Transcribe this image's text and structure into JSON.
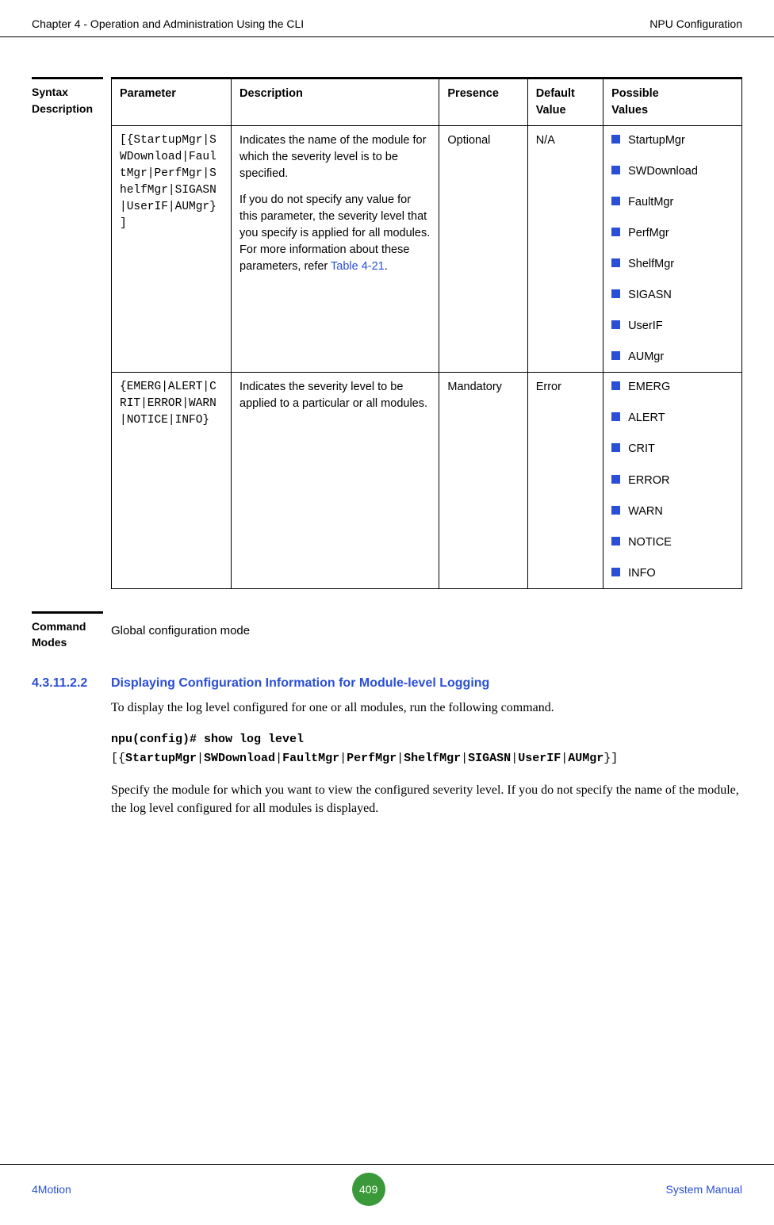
{
  "header": {
    "left": "Chapter 4 - Operation and Administration Using the CLI",
    "right": "NPU Configuration"
  },
  "syntax": {
    "label_line1": "Syntax",
    "label_line2": "Description",
    "columns": {
      "parameter": "Parameter",
      "description": "Description",
      "presence": "Presence",
      "default_value_l1": "Default",
      "default_value_l2": "Value",
      "possible_values_l1": "Possible",
      "possible_values_l2": "Values"
    },
    "rows": [
      {
        "parameter": "[{StartupMgr|SWDownload|FaultMgr|PerfMgr|ShelfMgr|SIGASN|UserIF|AUMgr}]",
        "desc_p1": "Indicates the name of the module for which the severity level is to be specified.",
        "desc_p2_a": "If you do not specify any value for this parameter, the severity level that you specify is applied for all modules. For more information about these parameters, refer ",
        "desc_p2_link": "Table 4-21",
        "desc_p2_b": ".",
        "presence": "Optional",
        "default": "N/A",
        "values": [
          "StartupMgr",
          "SWDownload",
          "FaultMgr",
          "PerfMgr",
          "ShelfMgr",
          "SIGASN",
          "UserIF",
          "AUMgr"
        ]
      },
      {
        "parameter": "{EMERG|ALERT|CRIT|ERROR|WARN|NOTICE|INFO}",
        "desc_p1": "Indicates the severity level to be applied to a particular or all modules.",
        "desc_p2_a": "",
        "desc_p2_link": "",
        "desc_p2_b": "",
        "presence": "Mandatory",
        "default": "Error",
        "values": [
          "EMERG",
          "ALERT",
          "CRIT",
          "ERROR",
          "WARN",
          "NOTICE",
          "INFO"
        ]
      }
    ]
  },
  "command_modes": {
    "label_line1": "Command",
    "label_line2": "Modes",
    "value": "Global configuration mode"
  },
  "section": {
    "number": "4.3.11.2.2",
    "title": "Displaying Configuration Information for Module-level Logging",
    "intro": "To display the log level configured for one or all modules, run the following command.",
    "cmd_prefix": "npu(config)# show log level",
    "cmd_rest_open": "[{",
    "cmd_opts": [
      "StartupMgr",
      "SWDownload",
      "FaultMgr",
      "PerfMgr",
      "ShelfMgr",
      "SIGASN",
      "UserIF",
      "AUMgr"
    ],
    "cmd_rest_close": "}]",
    "after": "Specify the module for which you want to view the configured severity level. If you do not specify the name of the module, the log level configured for all modules is displayed."
  },
  "footer": {
    "left": "4Motion",
    "page": "409",
    "right": "System Manual"
  }
}
